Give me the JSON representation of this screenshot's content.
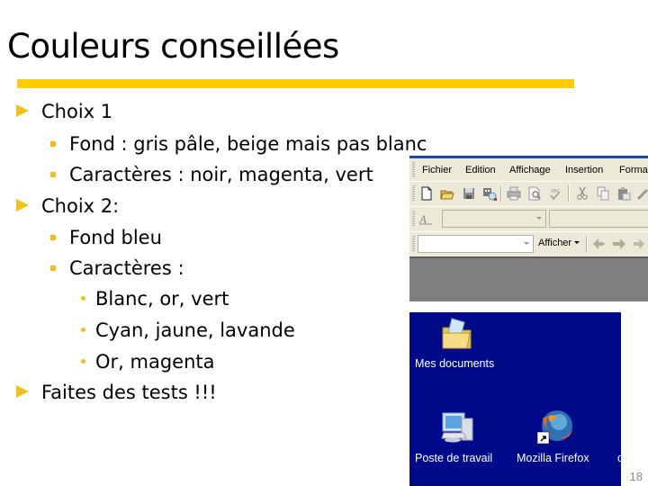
{
  "slide": {
    "title": "Couleurs conseillées",
    "accent_color": "#ffcc00",
    "bullet_color": "#f2c01a",
    "page_number": "18",
    "items": [
      {
        "level": 1,
        "marker": "arrow",
        "text": "Choix 1"
      },
      {
        "level": 2,
        "marker": "square",
        "text": "Fond : gris pâle, beige mais pas blanc"
      },
      {
        "level": 2,
        "marker": "square",
        "text": "Caractères : noir, magenta, vert"
      },
      {
        "level": 1,
        "marker": "arrow",
        "text": "Choix 2:"
      },
      {
        "level": 2,
        "marker": "square",
        "text": "Fond bleu"
      },
      {
        "level": 2,
        "marker": "square",
        "text": "Caractères :"
      },
      {
        "level": 3,
        "marker": "dot",
        "text": "Blanc, or, vert"
      },
      {
        "level": 3,
        "marker": "dot",
        "text": "Cyan, jaune, lavande"
      },
      {
        "level": 3,
        "marker": "dot",
        "text": "Or, magenta"
      },
      {
        "level": 1,
        "marker": "arrow",
        "text": "Faites des tests !!!"
      }
    ]
  },
  "app_screenshot": {
    "menu": [
      "Fichier",
      "Edition",
      "Affichage",
      "Insertion",
      "Format"
    ],
    "toolbar_icons": [
      "new-document-icon",
      "open-folder-icon",
      "save-icon",
      "permissions-icon",
      "print-icon",
      "print-preview-icon",
      "spellcheck-icon",
      "cut-icon",
      "copy-icon",
      "paste-icon",
      "format-painter-icon"
    ],
    "afficher_label": "Afficher",
    "style_combo_value": "",
    "address_combo_value": ""
  },
  "desktop_screenshot": {
    "background": "#020a8c",
    "icons": [
      {
        "label": "Mes documents",
        "icon": "my-documents-folder-icon"
      },
      {
        "label": "Poste de travail",
        "icon": "my-computer-icon"
      },
      {
        "label": "Mozilla Firefox",
        "icon": "firefox-icon"
      }
    ]
  }
}
